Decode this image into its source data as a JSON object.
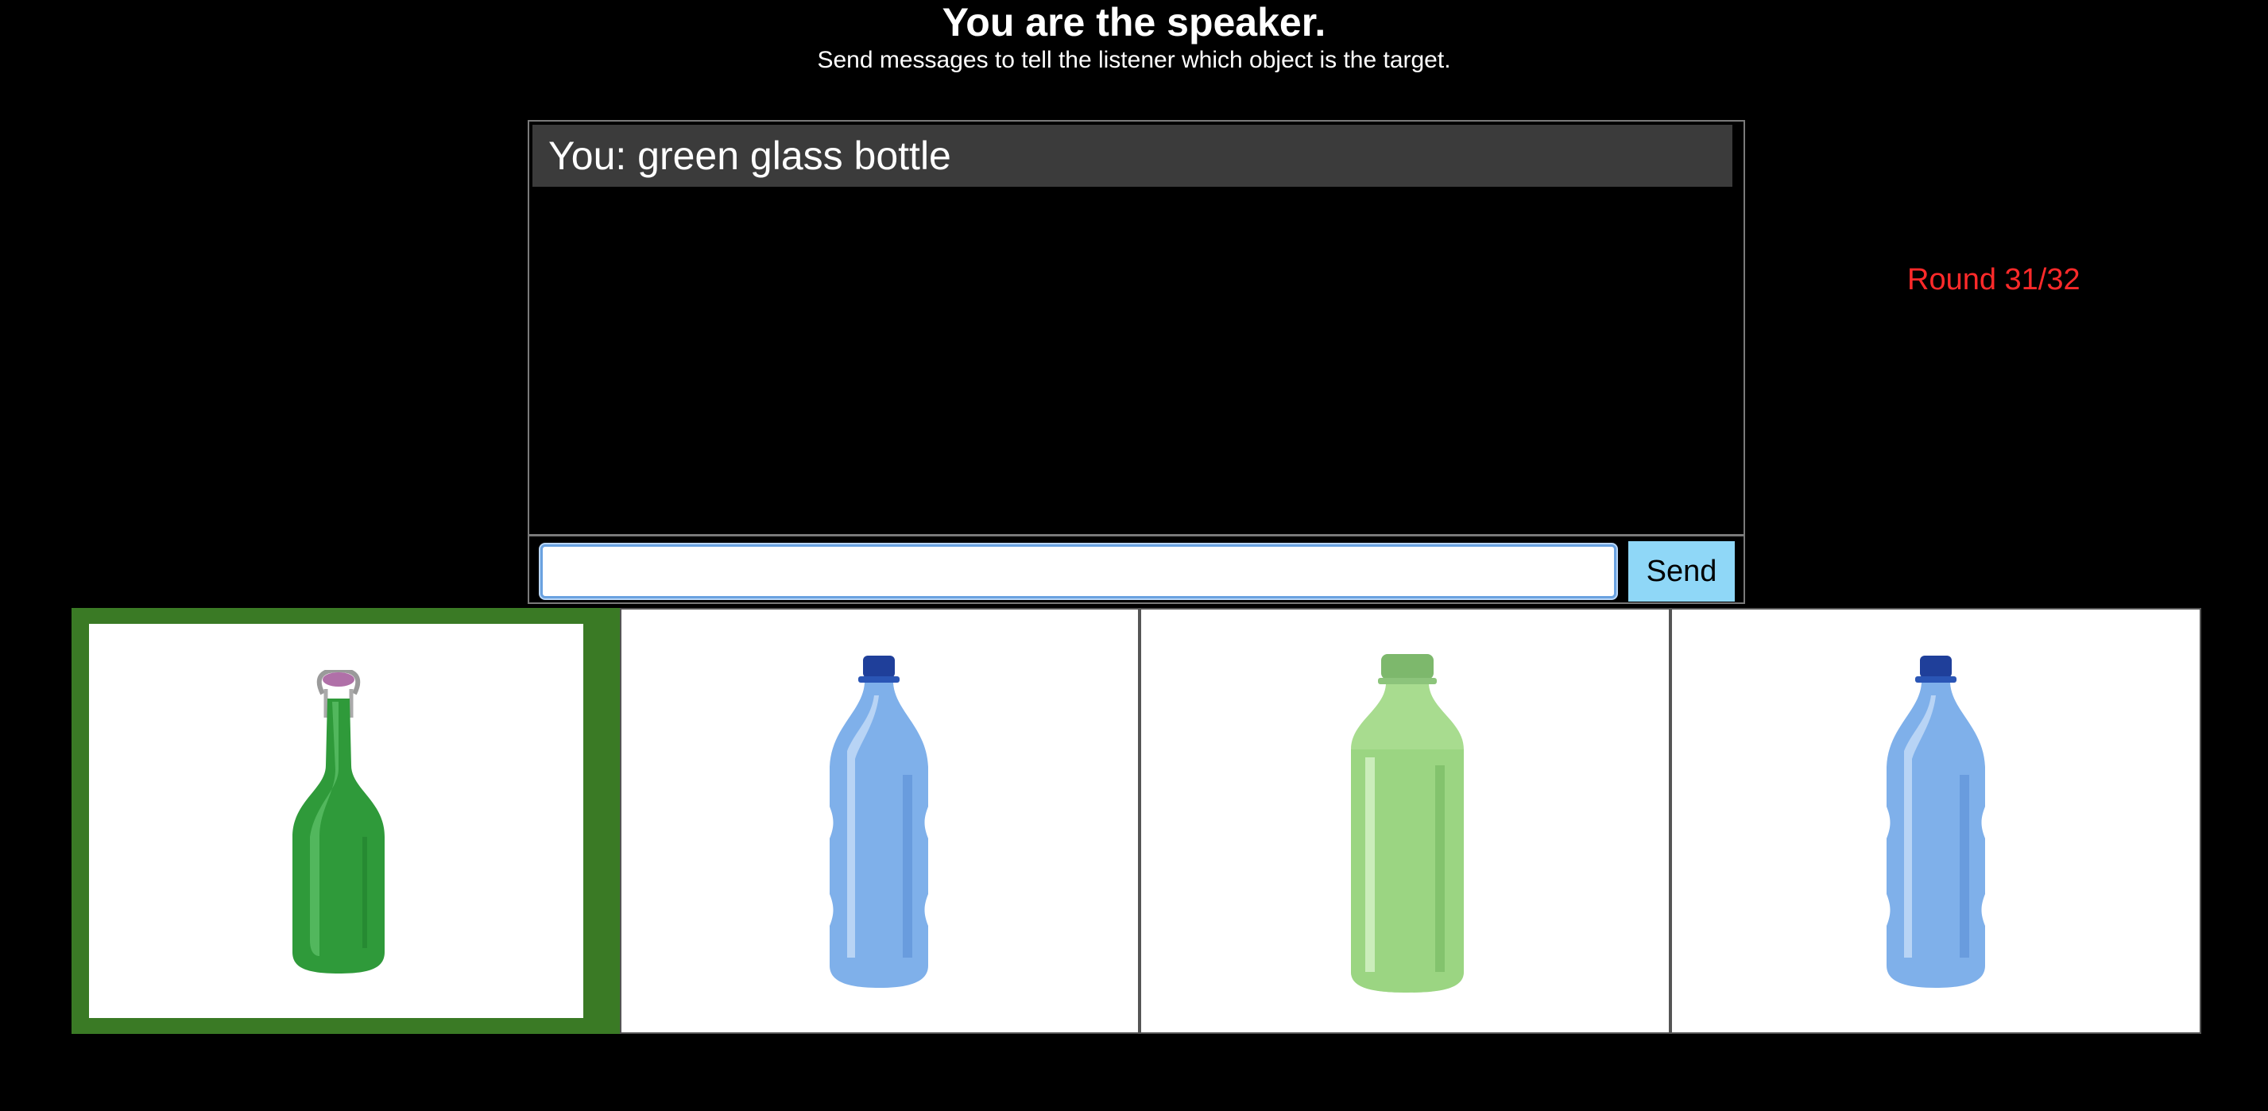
{
  "header": {
    "title": "You are the speaker.",
    "subtitle": "Send messages to tell the listener which object is the target."
  },
  "chat": {
    "messages": [
      {
        "text": "You: green glass bottle"
      }
    ],
    "input_value": "",
    "send_label": "Send"
  },
  "status": {
    "round": "Round 31/32",
    "round_color": "#ff2a2a"
  },
  "objects": [
    {
      "name": "green glass swing-top bottle",
      "icon": "green-glass-bottle-icon",
      "selected_target": true
    },
    {
      "name": "blue plastic water bottle",
      "icon": "blue-plastic-bottle-icon",
      "selected_target": false
    },
    {
      "name": "light green plastic bottle",
      "icon": "green-plastic-bottle-icon",
      "selected_target": false
    },
    {
      "name": "blue plastic water bottle",
      "icon": "blue-plastic-bottle-icon",
      "selected_target": false
    }
  ],
  "colors": {
    "target_border": "#3a7a25",
    "send_button": "#8fd7f7",
    "message_bg": "#3b3b3b"
  }
}
